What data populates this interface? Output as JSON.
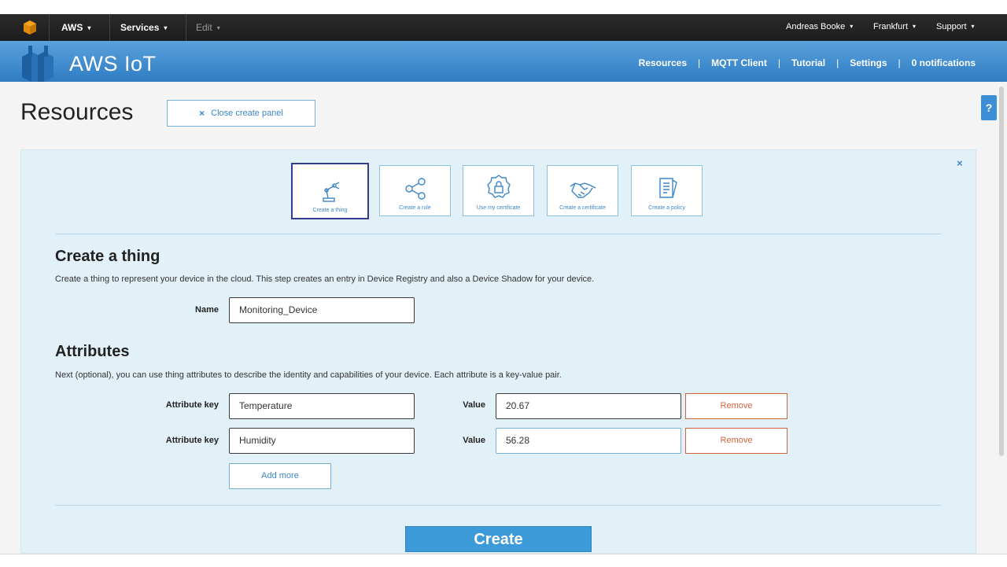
{
  "topbar": {
    "aws_label": "AWS",
    "services_label": "Services",
    "edit_label": "Edit",
    "user_label": "Andreas Booke",
    "region_label": "Frankfurt",
    "support_label": "Support",
    "caret": "▾"
  },
  "header": {
    "title": "AWS IoT",
    "nav": [
      "Resources",
      "MQTT Client",
      "Tutorial",
      "Settings",
      "0 notifications"
    ],
    "nav_separator": "|"
  },
  "page": {
    "title": "Resources",
    "close_panel_label": "Close create panel",
    "close_panel_x": "×",
    "help_label": "?",
    "panel_close": "×"
  },
  "tiles": [
    {
      "label": "Create a thing",
      "icon": "robot-arm-icon",
      "selected": true
    },
    {
      "label": "Create a rule",
      "icon": "share-nodes-icon",
      "selected": false
    },
    {
      "label": "Use my certificate",
      "icon": "certificate-lock-icon",
      "selected": false
    },
    {
      "label": "Create a certificate",
      "icon": "handshake-icon",
      "selected": false
    },
    {
      "label": "Create a policy",
      "icon": "document-policy-icon",
      "selected": false
    }
  ],
  "thing": {
    "heading": "Create a thing",
    "description": "Create a thing to represent your device in the cloud. This step creates an entry in Device Registry and also a Device Shadow for your device.",
    "name_label": "Name",
    "name_value": "Monitoring_Device"
  },
  "attributes": {
    "heading": "Attributes",
    "description": "Next (optional), you can use thing attributes to describe the identity and capabilities of your device. Each attribute is a key-value pair.",
    "key_label": "Attribute key",
    "value_label": "Value",
    "remove_label": "Remove",
    "rows": [
      {
        "key": "Temperature",
        "value": "20.67"
      },
      {
        "key": "Humidity",
        "value": "56.28"
      }
    ],
    "add_more_label": "Add more"
  },
  "actions": {
    "create_label": "Create"
  },
  "colors": {
    "topbar": "#1c1c1c",
    "header": "#3f8ccc",
    "panel": "#e2f1f8",
    "accent": "#3d86c6",
    "remove": "#d2643c",
    "create": "#3c9ad9"
  }
}
